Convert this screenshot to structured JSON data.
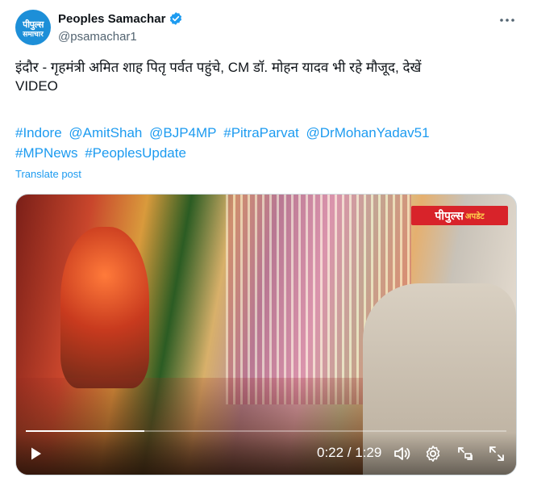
{
  "account": {
    "avatar_line1": "पीपुल्स",
    "avatar_line2": "समाचार",
    "display_name": "Peoples Samachar",
    "handle": "@psamachar1",
    "verified": true
  },
  "post": {
    "text": "इंदौर - गृहमंत्री अमित शाह पितृ पर्वत पहुंचे, CM डॉ. मोहन यादव भी रहे मौजूद, देखें\nVIDEO",
    "hashtags": [
      "#Indore",
      "@AmitShah",
      "@BJP4MP",
      "#PitraParvat",
      "@DrMohanYadav51",
      "#MPNews",
      "#PeoplesUpdate"
    ],
    "translate_label": "Translate post"
  },
  "video": {
    "logo_main": "पीपुल्स",
    "logo_sub": "अपडेट",
    "current_time": "0:22",
    "duration": "1:29",
    "time_display": "0:22 / 1:29",
    "progress": 0.247
  },
  "colors": {
    "link": "#1d9bf0",
    "verified": "#1d9bf0",
    "muted": "#536471",
    "logo_red": "#d8232a"
  },
  "icons": [
    "verified-badge-icon",
    "more-icon",
    "play-icon",
    "volume-icon",
    "settings-icon",
    "pip-icon",
    "fullscreen-icon"
  ]
}
